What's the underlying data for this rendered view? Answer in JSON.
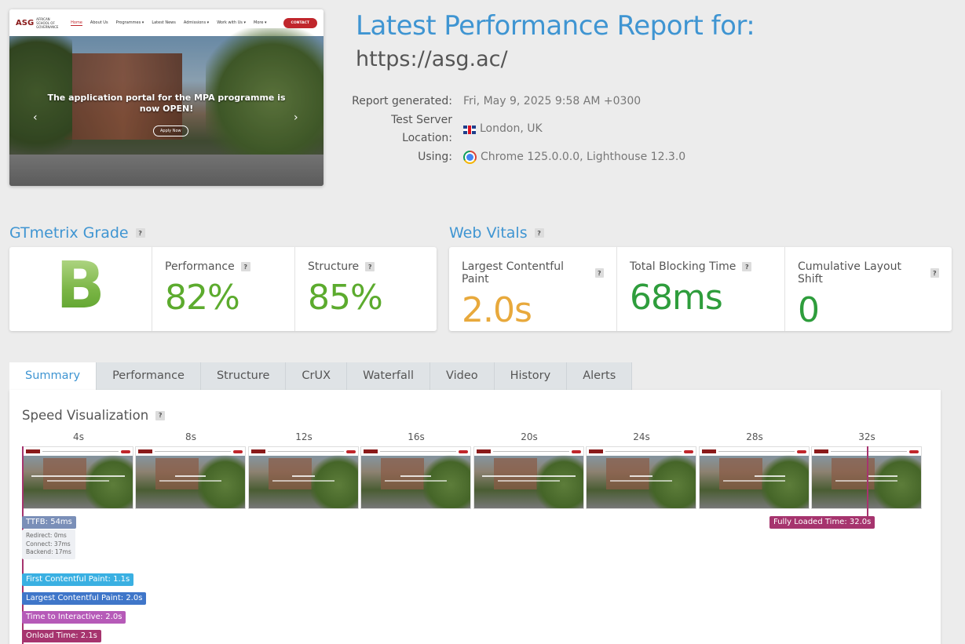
{
  "thumbnail": {
    "logo_mark": "ASG",
    "logo_text": "AFRICAN SCHOOL OF GOVERNANCE",
    "nav": [
      "Home",
      "About Us",
      "Programmes ▾",
      "Latest News",
      "Admissions ▾",
      "Work with Us ▾",
      "More ▾"
    ],
    "contact": "CONTACT",
    "caption_line1": "The application portal for the MPA programme is",
    "caption_line2": "now OPEN!",
    "apply_button": "Apply Now",
    "prev_arrow": "‹",
    "next_arrow": "›"
  },
  "report": {
    "title": "Latest Performance Report for:",
    "url": "https://asg.ac/",
    "meta": [
      {
        "key": "Report generated:",
        "value": "Fri, May 9, 2025 9:58 AM +0300",
        "icon": ""
      },
      {
        "key": "Test Server Location:",
        "value": "London, UK",
        "icon": "uk-flag-icon"
      },
      {
        "key": "Using:",
        "value": "Chrome 125.0.0.0, Lighthouse 12.3.0",
        "icon": "chrome-icon"
      }
    ]
  },
  "grade": {
    "heading": "GTmetrix Grade",
    "letter": "B",
    "performance_label": "Performance",
    "performance_value": "82%",
    "structure_label": "Structure",
    "structure_value": "85%"
  },
  "vitals": {
    "heading": "Web Vitals",
    "lcp_label": "Largest Contentful Paint",
    "lcp_value": "2.0s",
    "tbt_label": "Total Blocking Time",
    "tbt_value": "68ms",
    "cls_label": "Cumulative Layout Shift",
    "cls_value": "0"
  },
  "colors": {
    "accent": "#3f95d2",
    "good": "#5cab2e",
    "average": "#e8a93c",
    "great": "#2e9d3c"
  },
  "tabs": [
    "Summary",
    "Performance",
    "Structure",
    "CrUX",
    "Waterfall",
    "Video",
    "History",
    "Alerts"
  ],
  "speed": {
    "title": "Speed Visualization",
    "ticks": [
      "4s",
      "8s",
      "12s",
      "16s",
      "20s",
      "24s",
      "28s",
      "32s"
    ],
    "ttfb": "TTFB: 54ms",
    "redirect": "Redirect: 0ms",
    "connect": "Connect: 37ms",
    "backend": "Backend: 17ms",
    "fcp": "First Contentful Paint: 1.1s",
    "lcp": "Largest Contentful Paint: 2.0s",
    "tti": "Time to Interactive: 2.0s",
    "onload": "Onload Time: 2.1s",
    "fully_loaded": "Fully Loaded Time: 32.0s"
  }
}
